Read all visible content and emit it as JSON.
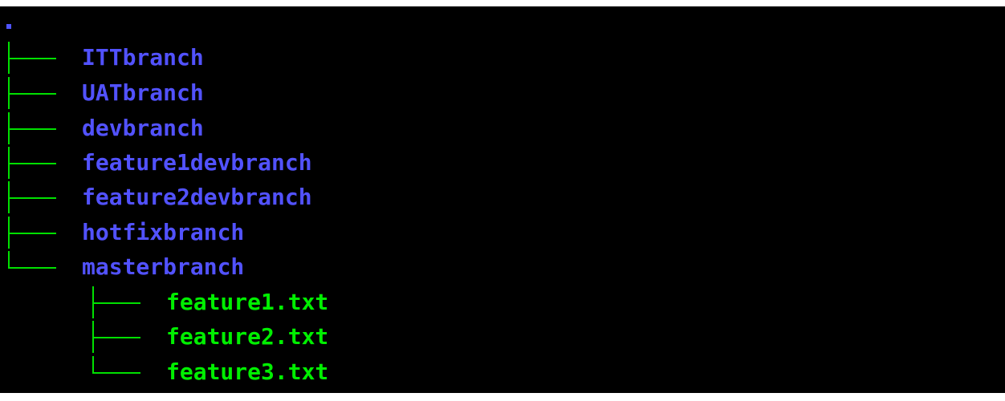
{
  "tree": {
    "root": ".",
    "directories": [
      {
        "name": "ITTbranch"
      },
      {
        "name": "UATbranch"
      },
      {
        "name": "devbranch"
      },
      {
        "name": "feature1devbranch"
      },
      {
        "name": "feature2devbranch"
      },
      {
        "name": "hotfixbranch"
      },
      {
        "name": "masterbranch"
      }
    ],
    "files": [
      {
        "name": "feature1.txt"
      },
      {
        "name": "feature2.txt"
      },
      {
        "name": "feature3.txt"
      }
    ]
  },
  "colors": {
    "background": "#000000",
    "directory": "#5252ff",
    "file": "#00ef00",
    "tree_lines": "#00e000"
  }
}
